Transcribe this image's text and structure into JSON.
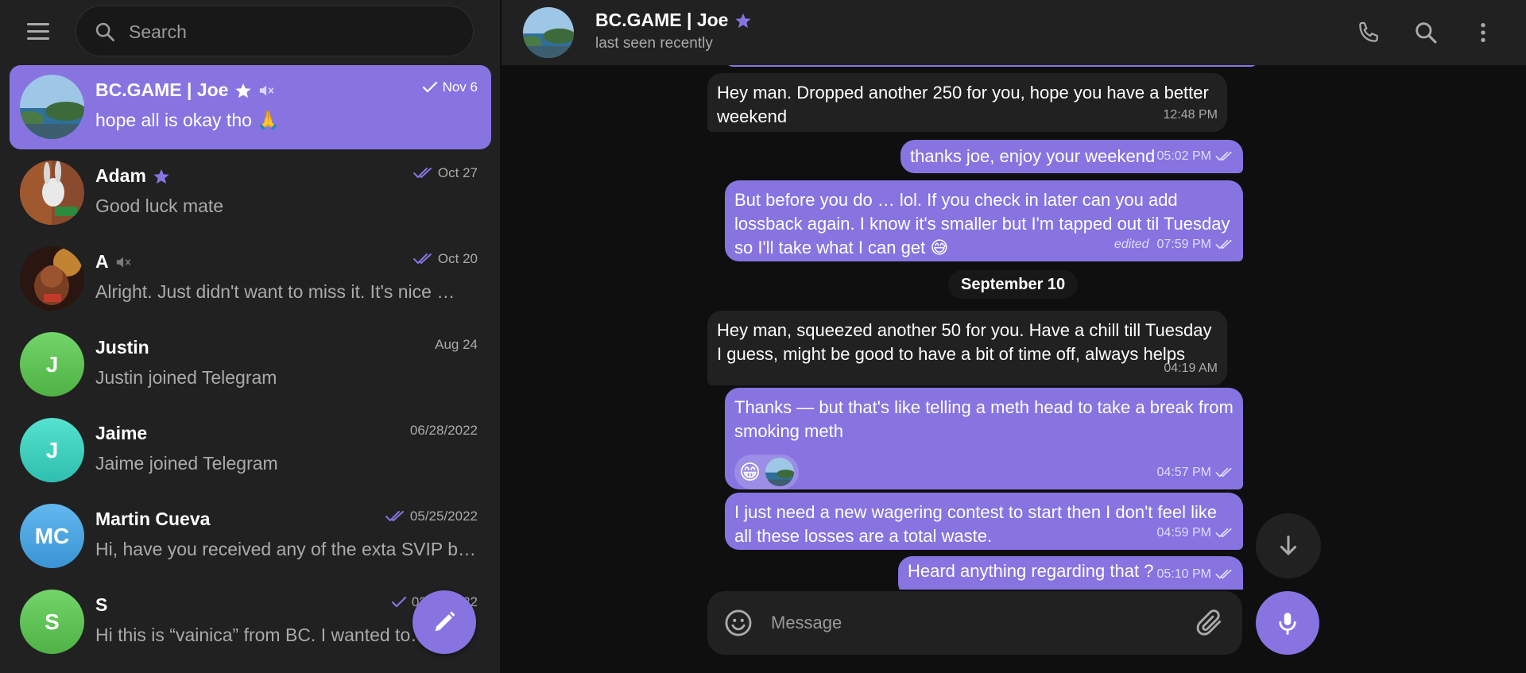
{
  "sidebar": {
    "search_placeholder": "Search",
    "chats": [
      {
        "name": "BC.GAME | Joe",
        "preview": "hope all is okay tho 🙏",
        "date": "Nov 6",
        "check": "single",
        "starred": true,
        "muted": true,
        "avatar": "photo-sea",
        "initials": "",
        "active": true
      },
      {
        "name": "Adam",
        "preview": "Good luck mate",
        "date": "Oct 27",
        "check": "double",
        "starred": true,
        "muted": false,
        "avatar": "photo-bunny",
        "initials": "",
        "active": false
      },
      {
        "name": "A",
        "preview": "Alright. Just didn't want to miss it. It's nice …",
        "date": "Oct 20",
        "check": "double",
        "starred": false,
        "muted": true,
        "avatar": "photo-bear",
        "initials": "",
        "active": false
      },
      {
        "name": "Justin",
        "preview": "Justin joined Telegram",
        "date": "Aug 24",
        "check": "none",
        "starred": false,
        "muted": false,
        "avatar": "initials",
        "initials": "J",
        "active": false
      },
      {
        "name": "Jaime",
        "preview": "Jaime joined Telegram",
        "date": "06/28/2022",
        "check": "none",
        "starred": false,
        "muted": false,
        "avatar": "initials",
        "initials": "J",
        "active": false
      },
      {
        "name": "Martin Cueva",
        "preview": "Hi, have you received any of the exta SVIP b…",
        "date": "05/25/2022",
        "check": "double",
        "starred": false,
        "muted": false,
        "avatar": "initials",
        "initials": "MC",
        "active": false
      },
      {
        "name": "S",
        "preview": "Hi this is “vainica” from BC. I wanted to…",
        "date": "02/…/2022",
        "check": "single",
        "starred": false,
        "muted": false,
        "avatar": "initials",
        "initials": "S",
        "active": false
      }
    ]
  },
  "header": {
    "title": "BC.GAME | Joe",
    "status": "last seen recently"
  },
  "messages": {
    "m1": {
      "text": "Hey man. Dropped another 250 for you, hope you have a better weekend",
      "time": "12:48 PM"
    },
    "m2": {
      "text": "thanks joe, enjoy your weekend",
      "time": "05:02 PM"
    },
    "m3": {
      "text": "But before you do … lol.     If you check in later can you add lossback again.   I know it's smaller but I'm tapped out til Tuesday so I'll take what I can get 😅",
      "time": "07:59 PM",
      "edited": "edited"
    },
    "date_separator": "September 10",
    "m4": {
      "text": "Hey man, squeezed another 50 for you. Have a chill till Tuesday I guess, might be good to have a bit of time off, always helps",
      "time": "04:19 AM"
    },
    "m5": {
      "text": "Thanks — but that's like telling a meth head to take a break from smoking meth",
      "time": "04:57 PM",
      "reaction": "😁"
    },
    "m6": {
      "text": "I just need a new wagering contest to start then I don't feel like all these losses are a total waste.",
      "time": "04:59 PM"
    },
    "m7": {
      "text": "Heard anything regarding that ?",
      "time": "05:10 PM"
    }
  },
  "composer": {
    "placeholder": "Message"
  },
  "colors": {
    "accent": "#8774e1",
    "sidebar_bg": "#212121",
    "chat_bg": "#0f0f0f",
    "incoming_bubble": "#212121",
    "avatar_green": "#5dc452",
    "avatar_teal": "#3fd1c1",
    "avatar_blue": "#4aa3df"
  }
}
